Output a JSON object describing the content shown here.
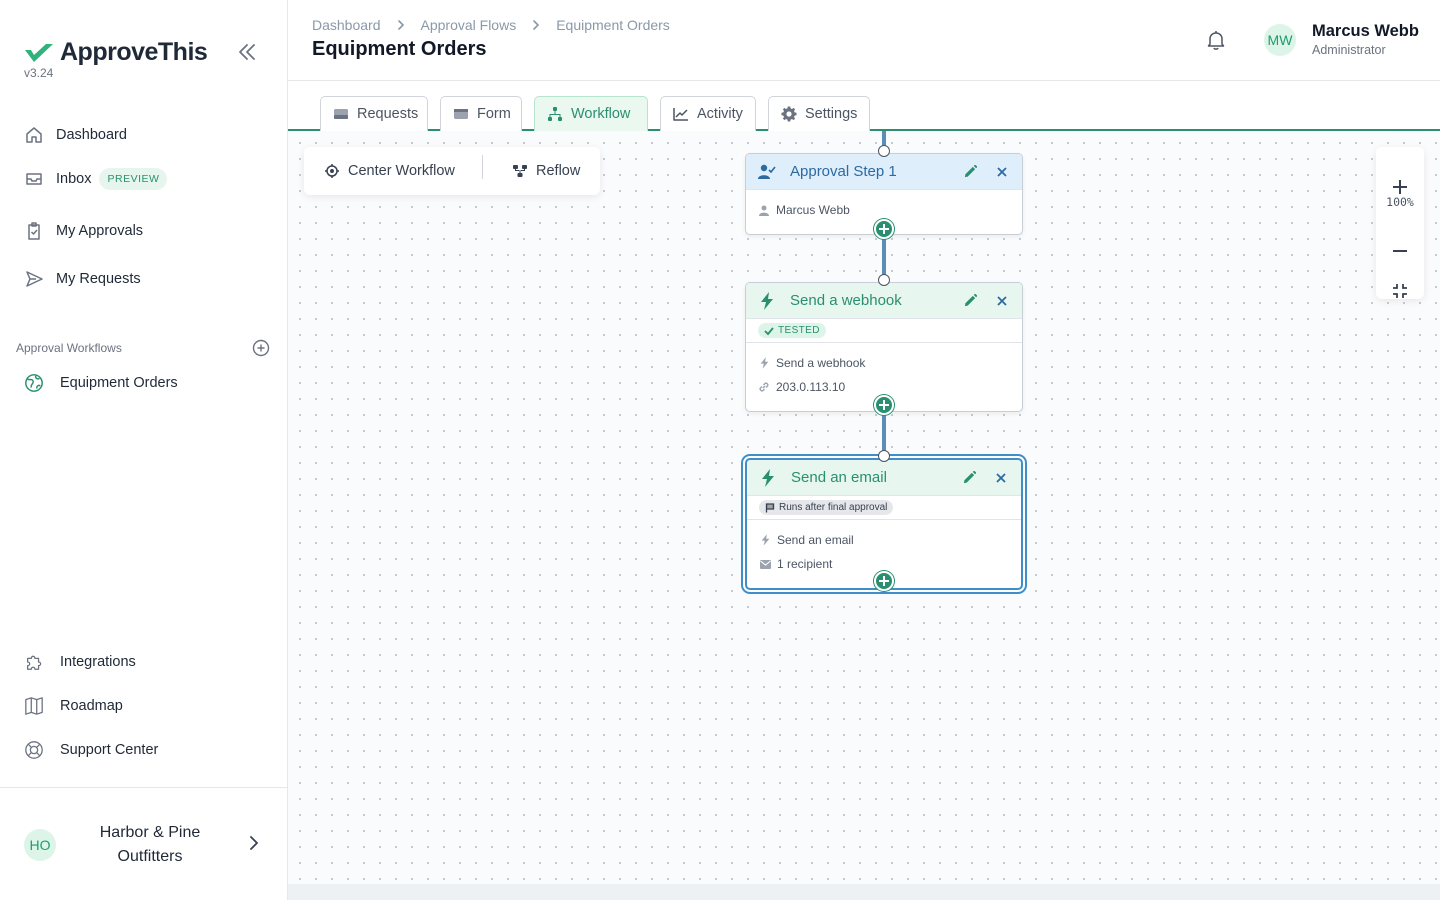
{
  "brand": {
    "name": "ApproveThis",
    "version": "v3.24"
  },
  "sidebar": {
    "nav": [
      {
        "label": "Dashboard"
      },
      {
        "label": "Inbox",
        "badge": "PREVIEW"
      },
      {
        "label": "My Approvals"
      },
      {
        "label": "My Requests"
      }
    ],
    "section_title": "Approval Workflows",
    "workflows": [
      {
        "label": "Equipment Orders"
      }
    ],
    "footer_links": [
      {
        "label": "Integrations"
      },
      {
        "label": "Roadmap"
      },
      {
        "label": "Support Center"
      }
    ],
    "org": {
      "initials": "HO",
      "name": "Harbor & Pine Outfitters"
    }
  },
  "header": {
    "breadcrumb": [
      "Dashboard",
      "Approval Flows",
      "Equipment Orders"
    ],
    "title": "Equipment Orders",
    "user": {
      "initials": "MW",
      "name": "Marcus Webb",
      "role": "Administrator"
    }
  },
  "tabs": [
    {
      "label": "Requests",
      "icon": "inbox-icon"
    },
    {
      "label": "Form",
      "icon": "form-icon"
    },
    {
      "label": "Workflow",
      "icon": "workflow-icon",
      "active": true
    },
    {
      "label": "Activity",
      "icon": "chart-line-icon"
    },
    {
      "label": "Settings",
      "icon": "gear-icon"
    }
  ],
  "toolbar": {
    "center_label": "Center Workflow",
    "reflow_label": "Reflow"
  },
  "zoom": {
    "level": "100%"
  },
  "nodes": [
    {
      "title": "Approval Step 1",
      "type": "approval",
      "lines": [
        "Marcus Webb"
      ]
    },
    {
      "title": "Send a webhook",
      "type": "action",
      "tag": "TESTED",
      "lines": [
        "Send a webhook",
        "203.0.113.10"
      ]
    },
    {
      "title": "Send an email",
      "type": "action",
      "tag": "Runs after final approval",
      "lines": [
        "Send an email",
        "1 recipient"
      ],
      "selected": true
    }
  ],
  "colors": {
    "accent": "#2a8f70",
    "approval": "#2c6aa0",
    "connector": "#5b8db8",
    "selection": "#3d8ec9"
  }
}
